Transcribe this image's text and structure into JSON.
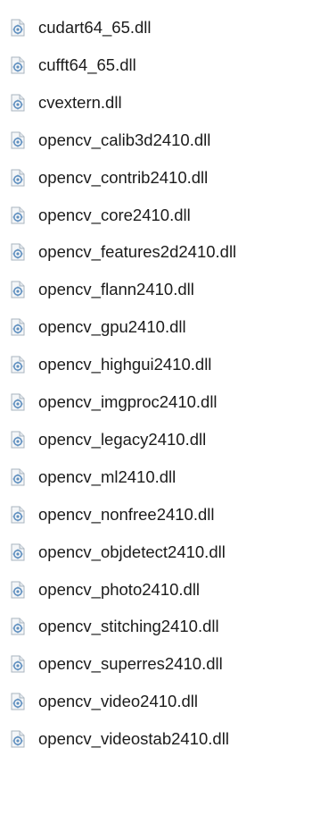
{
  "files": [
    {
      "name": "cudart64_65.dll",
      "icon": "dll-file-icon"
    },
    {
      "name": "cufft64_65.dll",
      "icon": "dll-file-icon"
    },
    {
      "name": "cvextern.dll",
      "icon": "dll-file-icon"
    },
    {
      "name": "opencv_calib3d2410.dll",
      "icon": "dll-file-icon"
    },
    {
      "name": "opencv_contrib2410.dll",
      "icon": "dll-file-icon"
    },
    {
      "name": "opencv_core2410.dll",
      "icon": "dll-file-icon"
    },
    {
      "name": "opencv_features2d2410.dll",
      "icon": "dll-file-icon"
    },
    {
      "name": "opencv_flann2410.dll",
      "icon": "dll-file-icon"
    },
    {
      "name": "opencv_gpu2410.dll",
      "icon": "dll-file-icon"
    },
    {
      "name": "opencv_highgui2410.dll",
      "icon": "dll-file-icon"
    },
    {
      "name": "opencv_imgproc2410.dll",
      "icon": "dll-file-icon"
    },
    {
      "name": "opencv_legacy2410.dll",
      "icon": "dll-file-icon"
    },
    {
      "name": "opencv_ml2410.dll",
      "icon": "dll-file-icon"
    },
    {
      "name": "opencv_nonfree2410.dll",
      "icon": "dll-file-icon"
    },
    {
      "name": "opencv_objdetect2410.dll",
      "icon": "dll-file-icon"
    },
    {
      "name": "opencv_photo2410.dll",
      "icon": "dll-file-icon"
    },
    {
      "name": "opencv_stitching2410.dll",
      "icon": "dll-file-icon"
    },
    {
      "name": "opencv_superres2410.dll",
      "icon": "dll-file-icon"
    },
    {
      "name": "opencv_video2410.dll",
      "icon": "dll-file-icon"
    },
    {
      "name": "opencv_videostab2410.dll",
      "icon": "dll-file-icon"
    }
  ],
  "colors": {
    "text": "#1b1b1b",
    "icon_page": "#f4f6f8",
    "icon_border": "#a9b4bf",
    "icon_gear": "#5f8fbf"
  }
}
